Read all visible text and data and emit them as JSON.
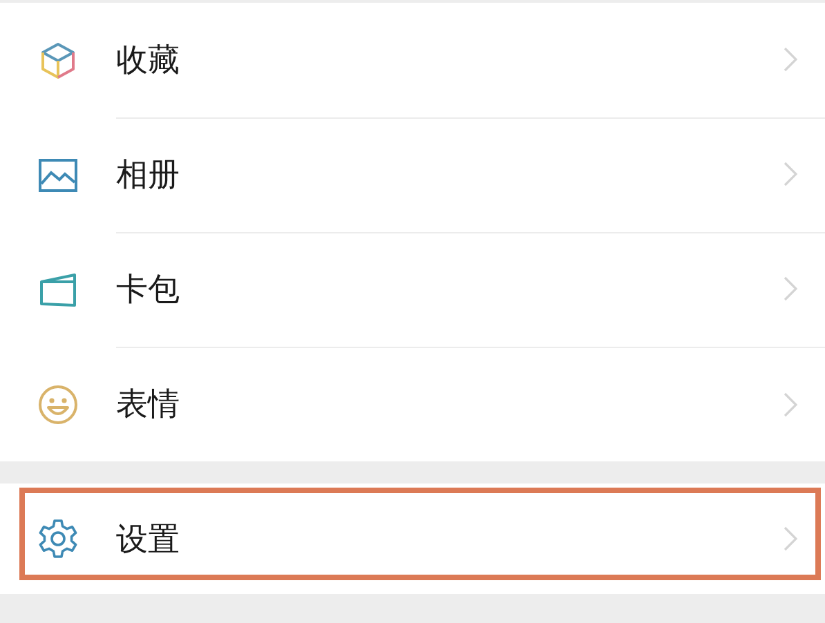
{
  "sections": [
    {
      "items": [
        {
          "label": "收藏",
          "kind": "favorites",
          "highlighted": false
        },
        {
          "label": "相册",
          "kind": "album",
          "highlighted": false
        },
        {
          "label": "卡包",
          "kind": "cards",
          "highlighted": false
        },
        {
          "label": "表情",
          "kind": "stickers",
          "highlighted": false
        }
      ]
    },
    {
      "items": [
        {
          "label": "设置",
          "kind": "settings",
          "highlighted": true
        }
      ]
    }
  ]
}
